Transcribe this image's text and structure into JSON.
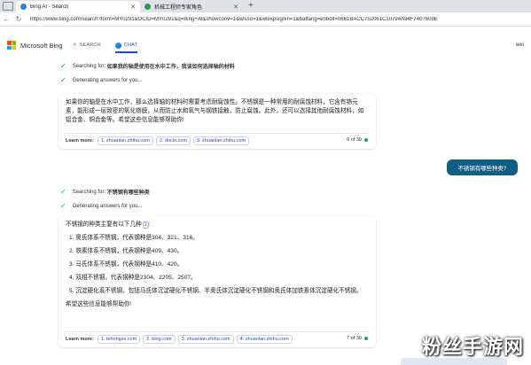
{
  "browser": {
    "tabs": [
      {
        "title": "Bing AI - Search",
        "active": true,
        "favicon_color": "#2c7be5"
      },
      {
        "title": "机械工程师专家角色",
        "active": false,
        "favicon_color": "#2e9b4f"
      }
    ],
    "new_tab": "+",
    "url": "https://www.bing.com/search?form=MY0291&OCID=MY0291&q=Bing+AI&showconv=1&wlsso=1&wlexpsignin=1&battang=enbolt=0661BACC752061C10794A94F7407609E"
  },
  "header": {
    "brand": "Microsoft Bing",
    "nav": [
      {
        "label": "SEARCH",
        "icon": "search-icon",
        "active": false
      },
      {
        "label": "CHAT",
        "icon": "chat-icon",
        "active": true
      }
    ],
    "profile": "wei",
    "logo_colors": [
      "#f25022",
      "#7fba00",
      "#00a4ef",
      "#ffb900"
    ]
  },
  "conversation": {
    "status1": {
      "prefix": "Searching for:",
      "query": "如果我的轴是使用在水中工作，我该如何选择轴的材料"
    },
    "status2": "Generating answers for you...",
    "answer1": {
      "text": "如果你的轴是在水中工作，那么选择轴的材料时需要考虑耐腐蚀性。不锈钢是一种常用的耐腐蚀材料，它含有铬元素，能形成一层致密的氧化铬膜，从而防止水和氧气与钢铁接触，防止腐蚀。此外，还可以选择其他耐腐蚀材料，如铝合金、铜合金等。希望这些信息能够帮助你!",
      "learn_more": "Learn more:",
      "sources": [
        "1. zhuanlan.zhihu.com",
        "2. docin.com",
        "3. zhuanlan.zhihu.com"
      ],
      "counter": "6 of 30"
    },
    "user_message": "不锈钢有哪些种类?",
    "status3": {
      "prefix": "Searching for:",
      "query": "不锈钢有哪些种类"
    },
    "status4": "Generating answers for you...",
    "answer2": {
      "intro": "不锈钢的种类主要有以下几种",
      "intro_ref": "1",
      "intro_tail": ":",
      "items": [
        "1. 奥氏体系不锈钢，代表钢种是304、321、316。",
        "2. 铁素体系不锈钢，代表钢种是409、430。",
        "3. 马氏体系不锈钢，代表钢种是410、420。",
        "4. 双相不锈钢，代表钢种是2304、2205、2507。",
        "5. 沉淀硬化系不锈钢，包括马氏体沉淀硬化不锈钢、半奥氏体沉淀硬化不锈钢和奥氏体加铁素体沉淀硬化不锈钢。"
      ],
      "closing": "希望这些信息能够帮助你!",
      "learn_more": "Learn more:",
      "sources": [
        "1. tehongss.com",
        "2. bing.com",
        "3. zhuanlan.zhihu.com",
        "4. zhuanlan.zhihu.com"
      ],
      "counter": "7 of 30"
    }
  },
  "watermark": "粉丝手游网"
}
